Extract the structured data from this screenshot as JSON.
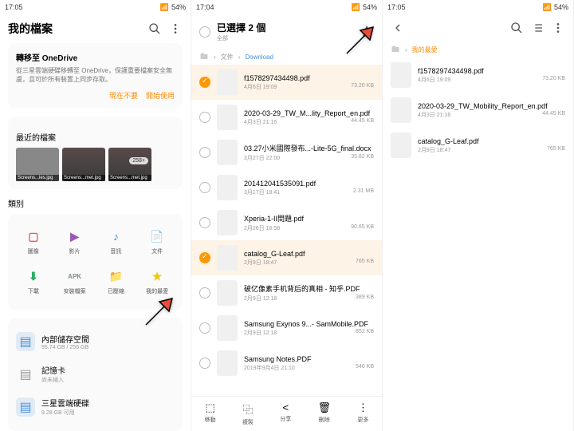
{
  "status": {
    "time1": "17:05",
    "time2": "17:04",
    "time3": "17:05",
    "battery": "54%"
  },
  "p1": {
    "title": "我的檔案",
    "od": {
      "title": "轉移至 OneDrive",
      "desc": "從三星雲端硬碟移轉至 OneDrive，保護重要檔案安全無虞，且可於所有裝置上同步存取。",
      "skip": "現在不要",
      "start": "開始使用"
    },
    "recent": "最近的檔案",
    "thumbs": [
      {
        "n": "Screens...les.jpg"
      },
      {
        "n": "Screens...met.jpg"
      },
      {
        "n": "Screens...met.jpg",
        "b": "258+"
      }
    ],
    "cattitle": "類別",
    "cats": [
      {
        "n": "圖像",
        "c": "#e85d5d",
        "g": "▢"
      },
      {
        "n": "影片",
        "c": "#9b59b6",
        "g": "▶"
      },
      {
        "n": "音訊",
        "c": "#3498db",
        "g": "♪"
      },
      {
        "n": "文件",
        "c": "#f39c12",
        "g": "📄"
      },
      {
        "n": "下載",
        "c": "#27ae60",
        "g": "⬇"
      },
      {
        "n": "安裝檔案",
        "c": "#7f8c8d",
        "g": "APK"
      },
      {
        "n": "已壓縮",
        "c": "#e67e22",
        "g": "📁"
      },
      {
        "n": "我的最愛",
        "c": "#f1c40f",
        "g": "★"
      }
    ],
    "storage": [
      {
        "n": "內部儲存空間",
        "s": "95.74 GB / 256 GB",
        "c": "#4a90d9"
      },
      {
        "n": "記憶卡",
        "s": "尚未插入",
        "c": "#999"
      },
      {
        "n": "三星雲端硬碟",
        "s": "9.28 GB 可用",
        "c": "#4a90d9"
      }
    ]
  },
  "p2": {
    "all": "全部",
    "title": "已選擇 2 個",
    "crumb": {
      "p": "文件",
      "c": "Download"
    },
    "files": [
      {
        "n": "f1578297434498.pdf",
        "d": "4月6日 19:09",
        "s": "73.20 KB",
        "sel": true
      },
      {
        "n": "2020-03-29_TW_M...lity_Report_en.pdf",
        "d": "4月3日 21:16",
        "s": "44.45 KB"
      },
      {
        "n": "03.27小米國際發布...-Lite-5G_final.docx",
        "d": "3月27日 22:00",
        "s": "35.82 KB"
      },
      {
        "n": "201412041535091.pdf",
        "d": "3月17日 18:41",
        "s": "2.31 MB"
      },
      {
        "n": "Xperia-1-II問題.pdf",
        "d": "2月26日 16:58",
        "s": "90.65 KB"
      },
      {
        "n": "catalog_G-Leaf.pdf",
        "d": "2月9日 18:47",
        "s": "765 KB",
        "sel": true
      },
      {
        "n": "破亿像素手机背后的真相 - 知乎.PDF",
        "d": "2月9日 12:18",
        "s": "389 KB"
      },
      {
        "n": "Samsung Exynos 9...- SamMobile.PDF",
        "d": "2月9日 12:18",
        "s": "852 KB"
      },
      {
        "n": "Samsung Notes.PDF",
        "d": "2019年9月4日 21:10",
        "s": "546 KB"
      }
    ],
    "bbar": [
      {
        "n": "移動",
        "g": "⬚"
      },
      {
        "n": "複製",
        "g": "⿻"
      },
      {
        "n": "分享",
        "g": "<"
      },
      {
        "n": "刪除",
        "g": "🗑"
      },
      {
        "n": "更多",
        "g": "⋮"
      }
    ]
  },
  "p3": {
    "crumb": "我的最愛",
    "files": [
      {
        "n": "f1578297434498.pdf",
        "d": "4月6日 19:09",
        "s": "73.20 KB"
      },
      {
        "n": "2020-03-29_TW_Mobility_Report_en.pdf",
        "d": "4月3日 21:16",
        "s": "44.45 KB"
      },
      {
        "n": "catalog_G-Leaf.pdf",
        "d": "2月9日 18:47",
        "s": "765 KB"
      }
    ]
  }
}
